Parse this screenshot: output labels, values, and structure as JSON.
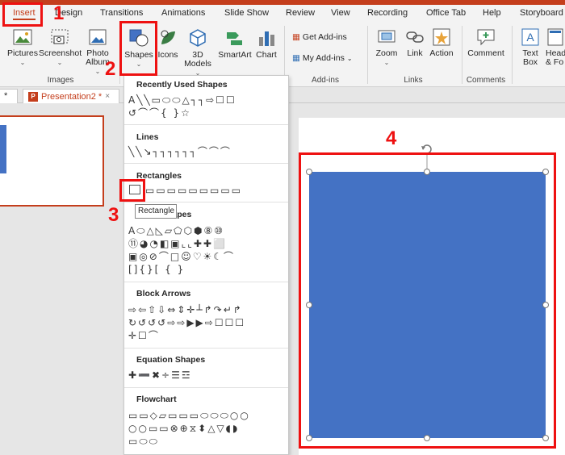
{
  "ribbon_tabs": [
    "Insert",
    "Design",
    "Transitions",
    "Animations",
    "Slide Show",
    "Review",
    "View",
    "Recording",
    "Office Tab",
    "Help",
    "Storyboard"
  ],
  "ribbon": {
    "pictures": "Pictures",
    "screenshot": "Screenshot",
    "photo_album": "Photo Album",
    "shapes": "Shapes",
    "icons": "Icons",
    "models_3d": "3D Models",
    "smartart": "SmartArt",
    "chart": "Chart",
    "get_addins": "Get Add-ins",
    "my_addins": "My Add-ins",
    "zoom": "Zoom",
    "link": "Link",
    "action": "Action",
    "comment": "Comment",
    "text_box": "Text Box",
    "header": "Head & Fo",
    "groups": {
      "images": "Images",
      "addins": "Add-ins",
      "links": "Links",
      "comments": "Comments"
    }
  },
  "doc_tabs": {
    "first": "*",
    "second": "Presentation2 *"
  },
  "shapes_menu": {
    "sections": {
      "recent": "Recently Used Shapes",
      "lines": "Lines",
      "rectangles": "Rectangles",
      "basic": "Basic Shapes",
      "block_arrows": "Block Arrows",
      "equation": "Equation Shapes",
      "flowchart": "Flowchart"
    },
    "recent_glyphs": "A╲╲▭⬭⬭△┐┐⇨☐☐",
    "recent_glyphs2": "↺⌒⌒{ }☆",
    "lines_glyphs": "╲╲↘┐┐┐┐┐┐⌒⌒⌒",
    "rect_glyphs": "▭▭▭▭▭▭▭▭▭",
    "basic_glyphs": [
      "A⬭△◺▱⬠⬡⬢⑧⑩",
      "⑪◕◔◧▣⌞⌞✚✚⬜",
      "▣◎⊘⌒□☺♡☀☾⌒",
      "[]{}[  {  }"
    ],
    "arrow_glyphs": [
      "⇨⇦⇧⇩⇔⇕✛┴↱↷↵↱",
      "↻↺↺↺⇨⇨▶▶⇨☐☐☐",
      "✛☐⌒"
    ],
    "equation_glyphs": "✚➖✖÷☰☲",
    "flow_glyphs": [
      "▭▭◇▱▭▭▭⬭⬭⬭○○",
      "○○▭▭⊗⊕⧖⬍△▽◖◗",
      "▭⬭⬭"
    ]
  },
  "tooltip": "Rectangle",
  "annotations": {
    "n1": "1",
    "n2": "2",
    "n3": "3",
    "n4": "4"
  },
  "colors": {
    "accent": "#c43e1c",
    "shape_fill": "#4472c4",
    "annotation": "#ee1111"
  }
}
